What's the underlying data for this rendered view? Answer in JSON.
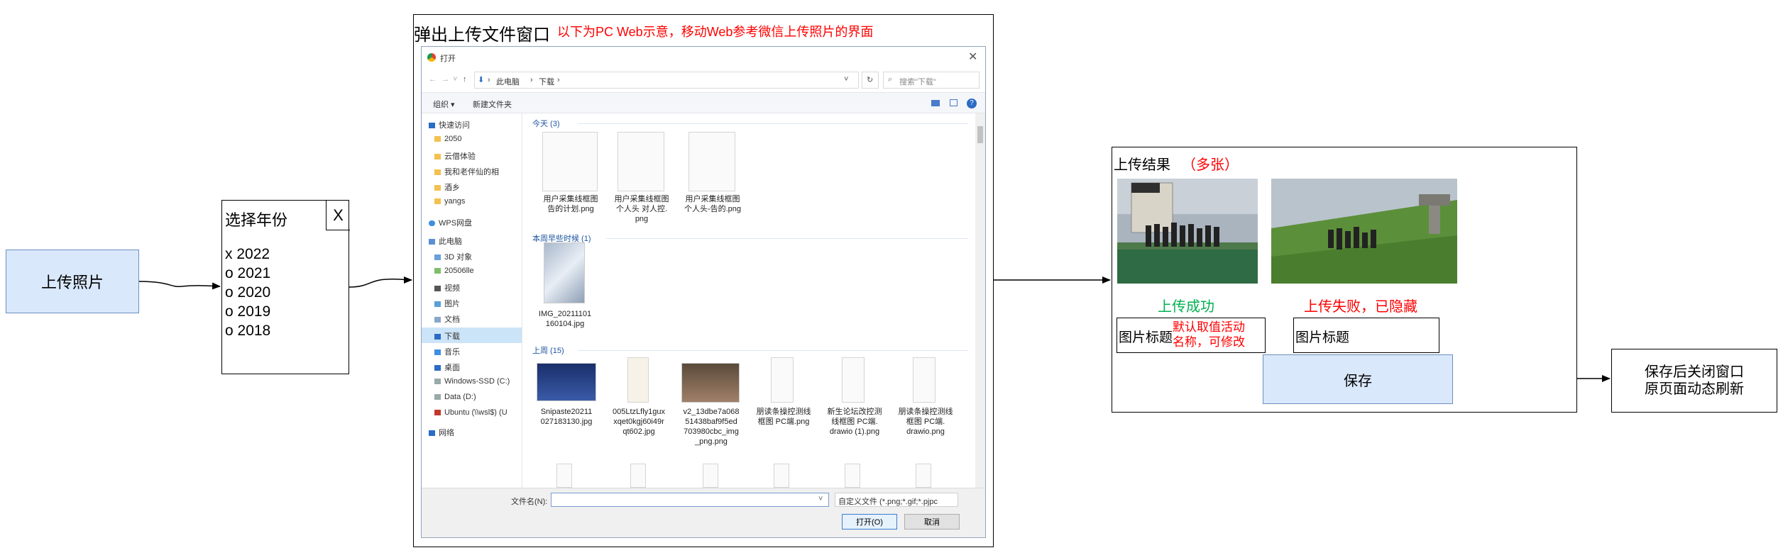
{
  "upload_photo": {
    "label": "上传照片"
  },
  "year_select": {
    "title": "选择年份",
    "close": "X",
    "options": [
      "x 2022",
      "o 2021",
      "o 2020",
      "o 2019",
      "o 2018"
    ]
  },
  "popup": {
    "title": "弹出上传文件窗口",
    "note": "以下为PC Web示意，移动Web参考微信上传照片的界面",
    "dialog": {
      "window_title": "打开",
      "path": [
        "此电脑",
        "下载"
      ],
      "search_placeholder": "搜索\"下载\"",
      "toolbar": {
        "organize": "组织 ▾",
        "new_folder": "新建文件夹"
      },
      "nav_items": [
        "快速访问",
        "2050",
        "云借体验",
        "我和老伴仙的相",
        "酒乡",
        "yangs",
        "WPS网盘",
        "此电脑",
        "3D 对象",
        "20506lle",
        "视频",
        "图片",
        "文档",
        "下载",
        "音乐",
        "桌面",
        "Windows-SSD (C:)",
        "Data (D:)",
        "Ubuntu (\\\\wsl$) (U",
        "网络"
      ],
      "groups": [
        {
          "header": "今天 (3)",
          "files": [
            "用户采集线框图\n告的计划.png",
            "用户采集线框图\n个人头 对人控.\npng",
            "用户采集线框图\n个人头-告的.png"
          ]
        },
        {
          "header": "本周早些时候 (1)",
          "files": [
            "IMG_20211101\n160104.jpg"
          ]
        },
        {
          "header": "上周 (15)",
          "files": [
            "Snipaste20211\n027183130.jpg",
            "005LtzLfly1gux\nxqet0kgj60i49r\nqt602.jpg",
            "v2_13dbe7a068\n51438baf9f5ed\n703980cbc_img\n_png.png",
            "朋读条操控测线\n框图 PC端.png",
            "新生论坛改控测\n线框图 PC端.\ndrawio (1).png",
            "朋读条操控测线\n框图 PC端.\ndrawio.png"
          ]
        }
      ],
      "filename_label": "文件名(N):",
      "filename_value": "",
      "filetype": "自定义文件 (*.png;*.gif;*.pjpc",
      "open_button": "打开(O)",
      "cancel_button": "取消"
    }
  },
  "result": {
    "title": "上传结果",
    "multi_note": "（多张）",
    "status_success": "上传成功",
    "status_fail": "上传失败，已隐藏",
    "caption_label_1": "图片标题",
    "caption_hint": "默认取值活动名称，可修改",
    "caption_label_2": "图片标题",
    "save": "保存"
  },
  "close_note": {
    "line1": "保存后关闭窗口",
    "line2": "原页面动态刷新"
  },
  "colors": {
    "blue_fill": "#dae8fc",
    "blue_stroke": "#6c8ebf",
    "red": "#ff0000",
    "green": "#00b050"
  }
}
